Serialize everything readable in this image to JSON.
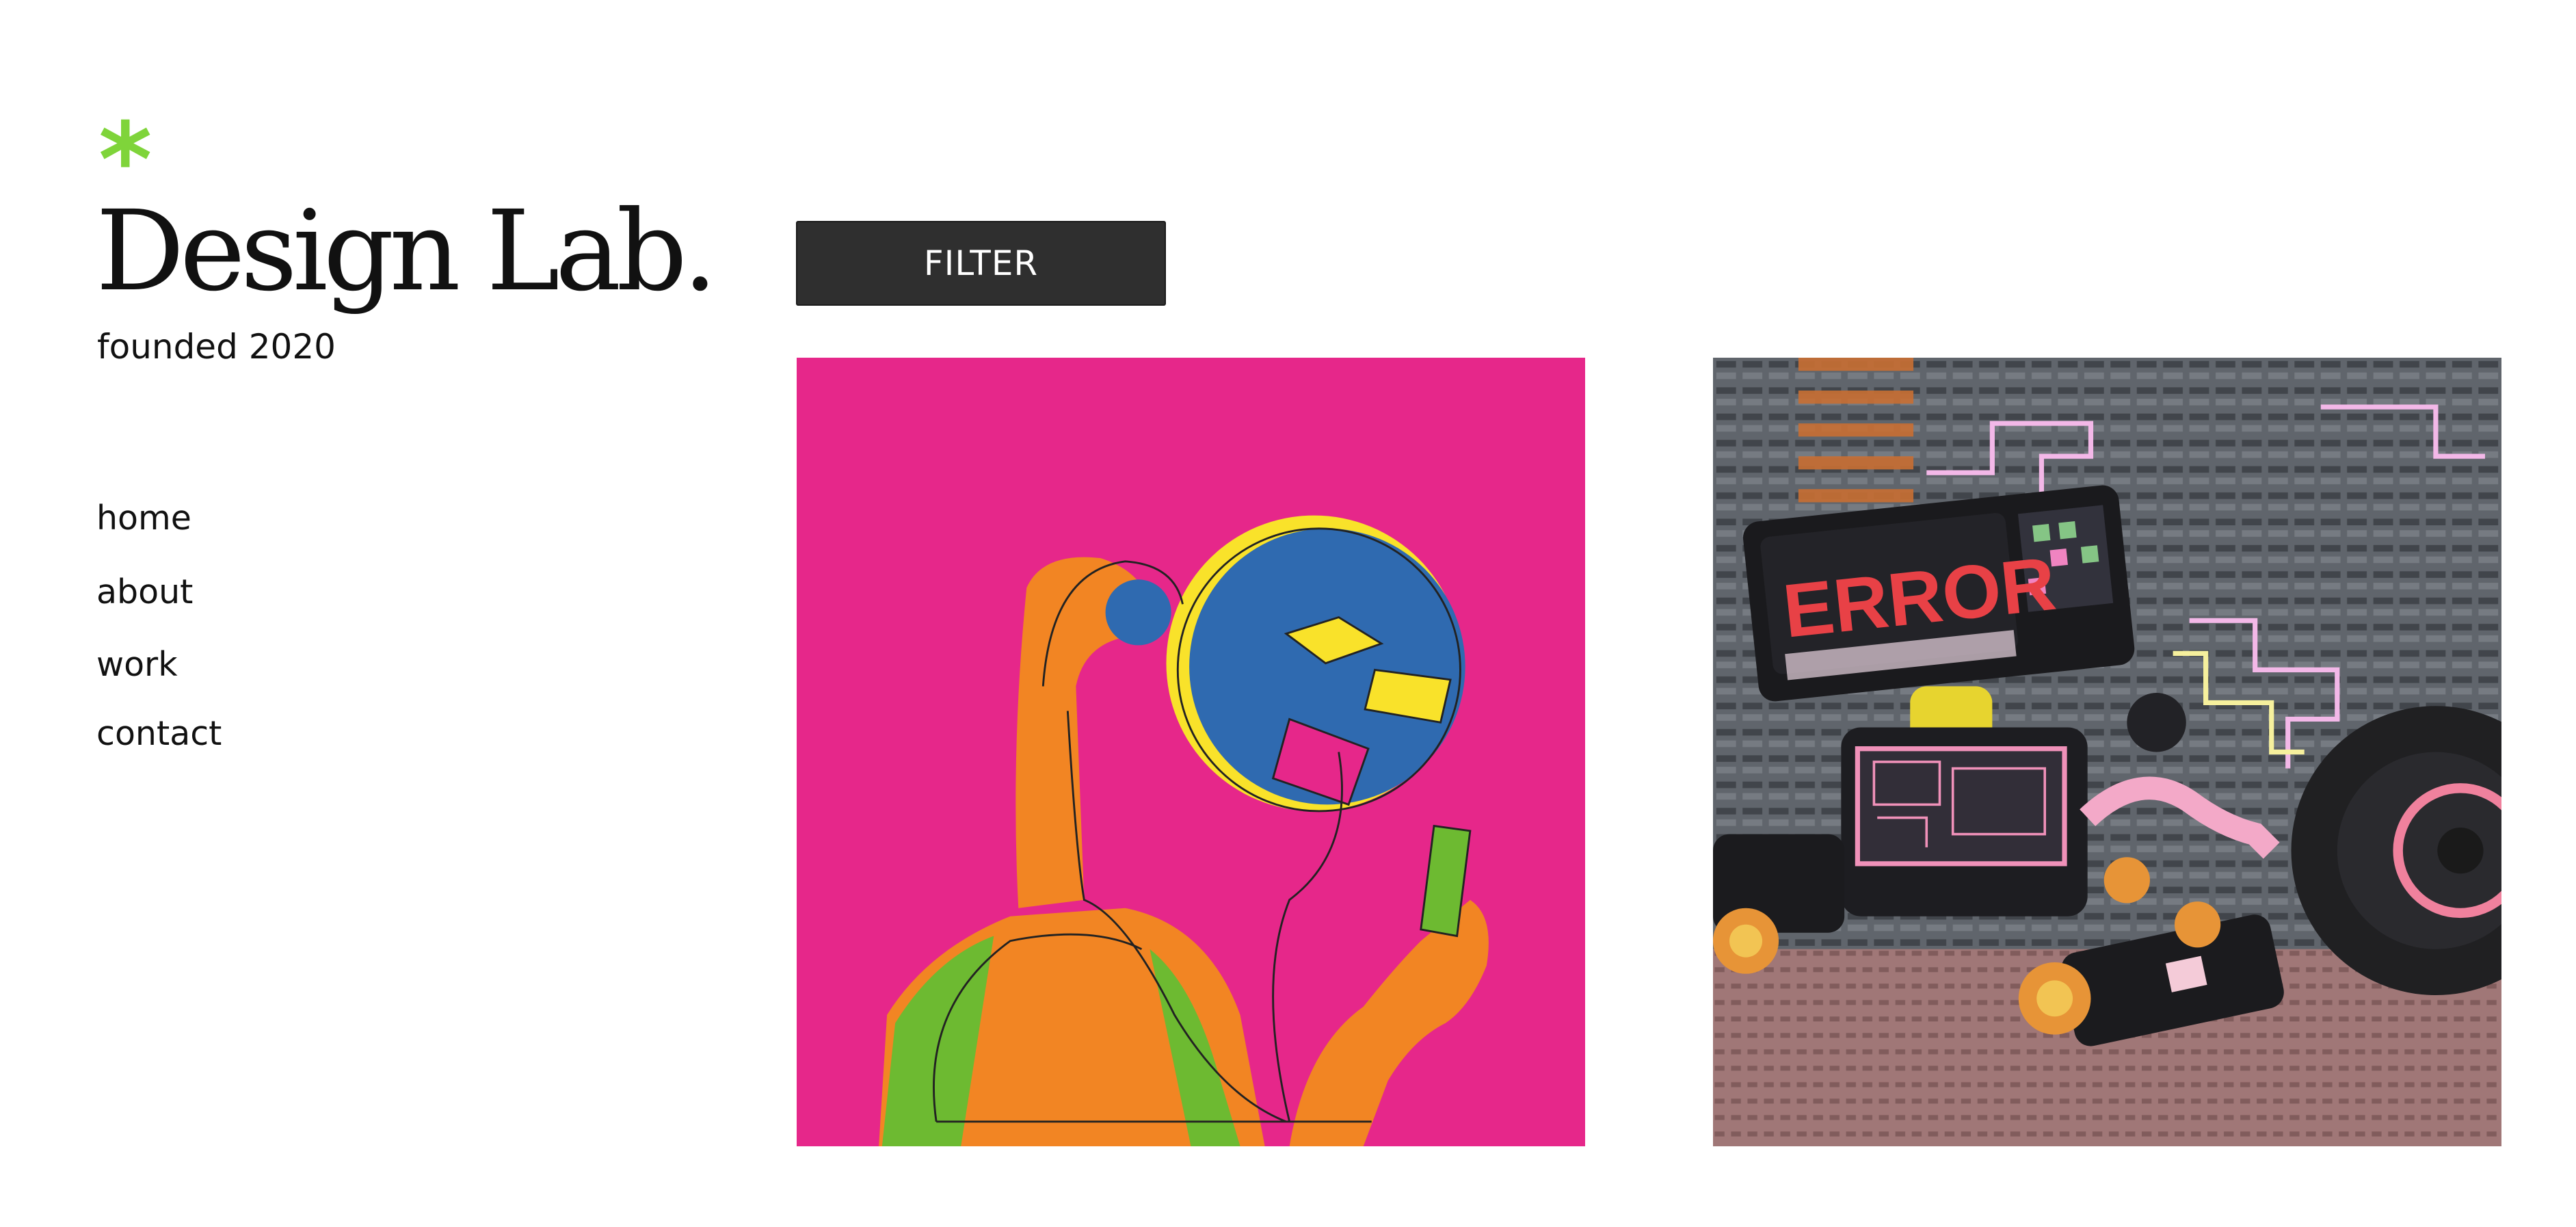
{
  "brand": {
    "mark": "*",
    "name": "Design Lab.",
    "tagline": "founded 2020",
    "accent_color": "#7fd43a"
  },
  "nav": {
    "items": [
      {
        "label": "home"
      },
      {
        "label": "about"
      },
      {
        "label": "work"
      },
      {
        "label": "contact"
      }
    ]
  },
  "toolbar": {
    "filter_label": "FILTER"
  },
  "gallery": {
    "items": [
      {
        "image": "pop-art illustration of figure with round blue head looking at phone",
        "background_color": "#e6278a"
      },
      {
        "image": "3D render of glossy black robot with ERROR screen and neon circuits",
        "screen_text": "ERROR"
      }
    ]
  }
}
